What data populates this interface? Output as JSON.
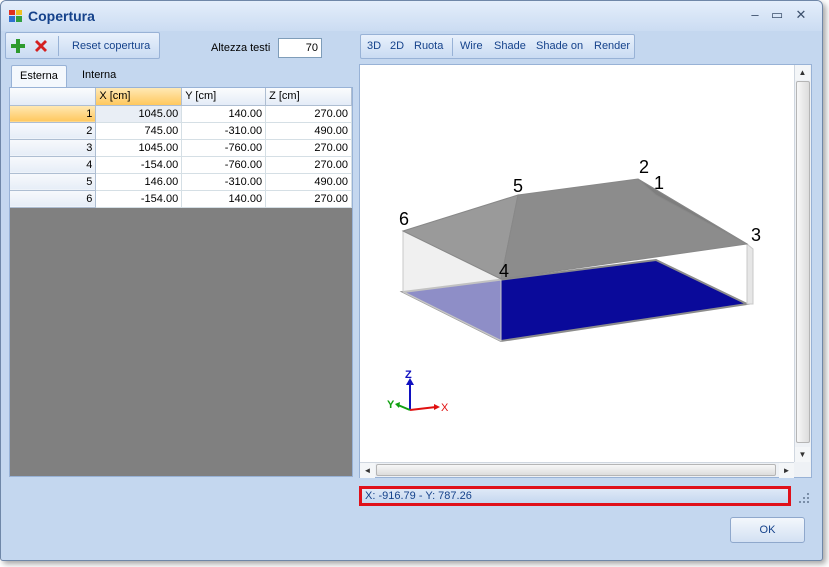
{
  "window": {
    "title": "Copertura",
    "minimize": "–",
    "maximize": "▭",
    "close": "✕"
  },
  "toolbar": {
    "add_icon": "plus-icon",
    "delete_icon": "red-x-icon",
    "reset_label": "Reset copertura",
    "altezza_label": "Altezza testi",
    "altezza_value": "70"
  },
  "tabs": [
    {
      "label": "Esterna",
      "active": true
    },
    {
      "label": "Interna",
      "active": false
    }
  ],
  "grid": {
    "columns": [
      "X [cm]",
      "Y [cm]",
      "Z [cm]"
    ],
    "rows": [
      {
        "id": "1",
        "x": "1045.00",
        "y": "140.00",
        "z": "270.00"
      },
      {
        "id": "2",
        "x": "745.00",
        "y": "-310.00",
        "z": "490.00"
      },
      {
        "id": "3",
        "x": "1045.00",
        "y": "-760.00",
        "z": "270.00"
      },
      {
        "id": "4",
        "x": "-154.00",
        "y": "-760.00",
        "z": "270.00"
      },
      {
        "id": "5",
        "x": "146.00",
        "y": "-310.00",
        "z": "490.00"
      },
      {
        "id": "6",
        "x": "-154.00",
        "y": "140.00",
        "z": "270.00"
      }
    ]
  },
  "view_toolbar": [
    "3D",
    "2D",
    "Ruota",
    "Wire",
    "Shade",
    "Shade on",
    "Render"
  ],
  "model_labels": [
    "1",
    "2",
    "3",
    "4",
    "5",
    "6"
  ],
  "axes": {
    "z": "Z",
    "y": "Y",
    "x": "X",
    "z_color": "#1010c0",
    "y_color": "#10a010",
    "x_color": "#e01010"
  },
  "colors": {
    "floor": "#0a0a9a",
    "roof": "#8c8c8c",
    "wall": "#e6e6e6",
    "highlight": "#e0101a"
  },
  "status": {
    "coords": "X: -916.79 - Y: 787.26"
  },
  "ok_label": "OK"
}
